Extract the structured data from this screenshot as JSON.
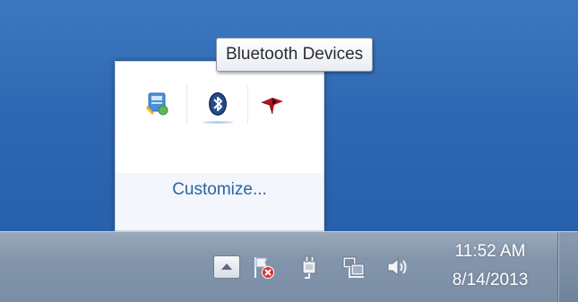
{
  "tooltip": {
    "text": "Bluetooth Devices"
  },
  "popup": {
    "icons": [
      "windows-update-icon",
      "bluetooth-icon",
      "red-app-icon"
    ],
    "customize_label": "Customize..."
  },
  "taskbar": {
    "icons": [
      "show-hidden-icons-arrow-icon",
      "action-center-flag-icon",
      "power-plug-icon",
      "network-icon",
      "volume-icon"
    ],
    "clock": {
      "time": "11:52 AM",
      "date": "8/14/2013"
    }
  },
  "colors": {
    "desktop": "#2f69b3",
    "taskbar": "#8395ab",
    "link": "#2a63a8",
    "error_badge": "#d9322b"
  }
}
